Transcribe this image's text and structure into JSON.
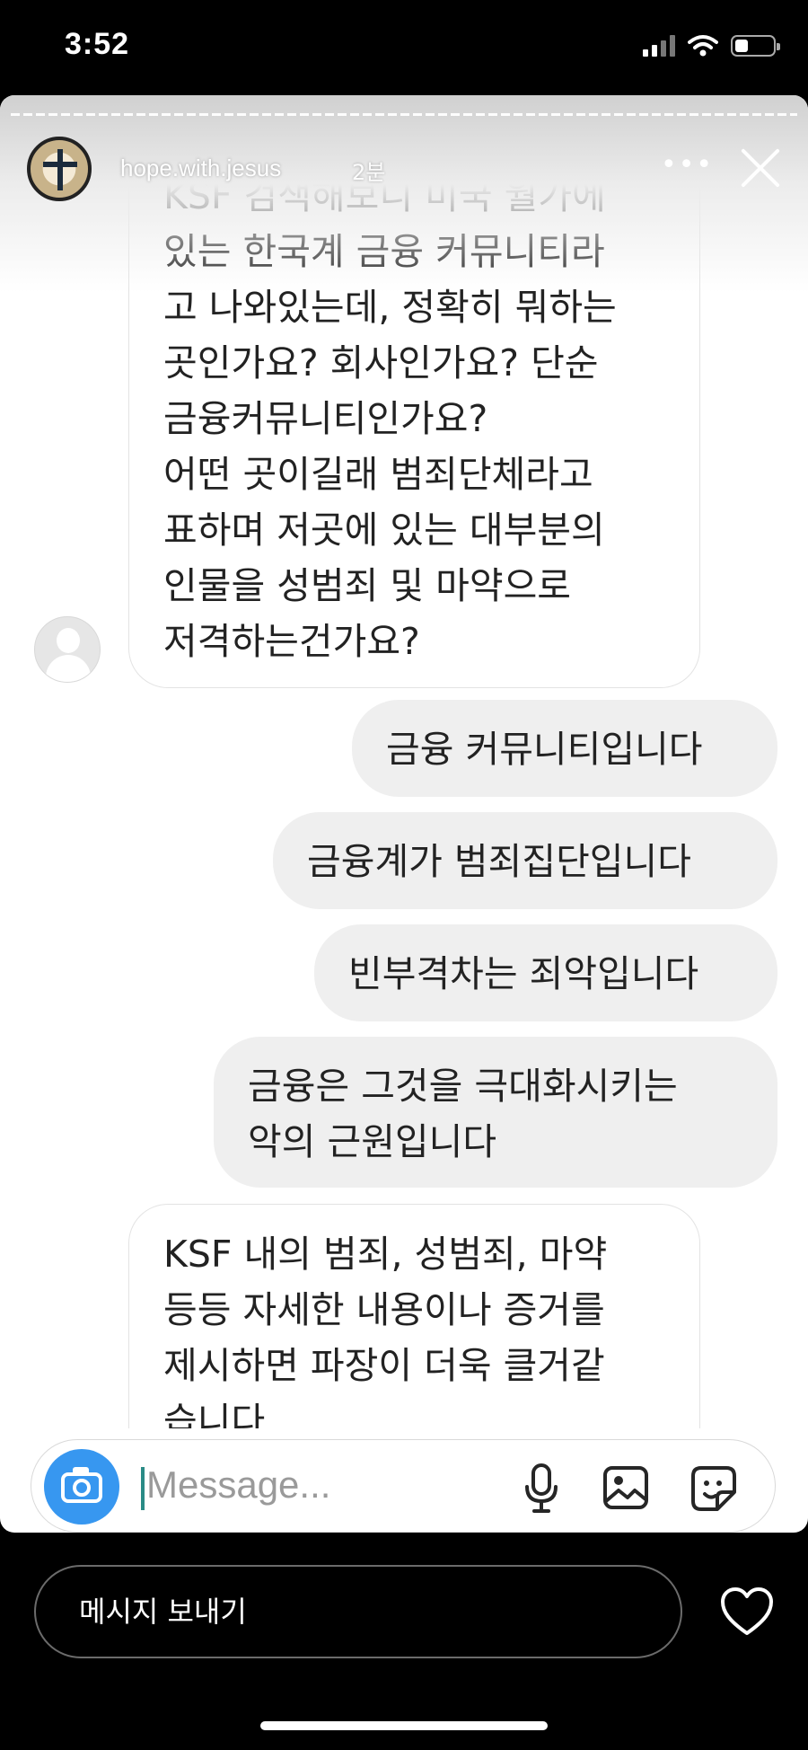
{
  "status_bar": {
    "time": "3:52"
  },
  "story": {
    "username": "hope.with.jesus",
    "time_ago": "2분",
    "more_label": "•••"
  },
  "messages": [
    {
      "direction": "incoming",
      "lines": [
        "KSF 검색해보니 미국 월가에",
        "있는 한국계 금융 커뮤니티라",
        "고 나와있는데, 정확히 뭐하는",
        "곳인가요? 회사인가요? 단순",
        "금융커뮤니티인가요?",
        "어떤 곳이길래 범죄단체라고",
        "표하며 저곳에 있는 대부분의",
        "인물을 성범죄 및 마약으로",
        "저격하는건가요?"
      ]
    },
    {
      "direction": "outgoing",
      "lines": [
        "금융 커뮤니티입니다"
      ]
    },
    {
      "direction": "outgoing",
      "lines": [
        "금융계가 범죄집단입니다"
      ]
    },
    {
      "direction": "outgoing",
      "lines": [
        "빈부격차는 죄악입니다"
      ]
    },
    {
      "direction": "outgoing",
      "lines": [
        "금융은 그것을 극대화시키는",
        "악의 근원입니다"
      ]
    },
    {
      "direction": "incoming",
      "lines": [
        "KSF 내의 범죄, 성범죄, 마약",
        "등등 자세한 내용이나 증거를",
        "제시하면 파장이 더욱 클거같",
        "습니다"
      ]
    }
  ],
  "composer": {
    "placeholder": "Message..."
  },
  "reply_bar": {
    "placeholder": "메시지 보내기"
  },
  "colors": {
    "camera_button": "#3797f0",
    "outgoing_bubble": "#efefef",
    "incoming_bubble_border": "#e3e3e3"
  }
}
